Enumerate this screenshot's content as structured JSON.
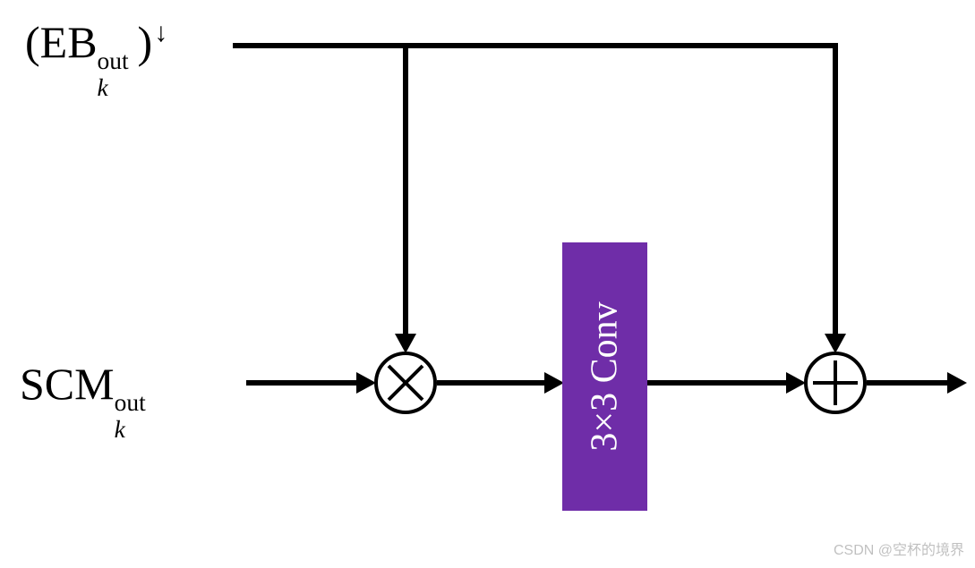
{
  "inputs": {
    "eb": {
      "prefix": "(EB",
      "sup": "out",
      "sub": "k",
      "suffix": ")",
      "arrow_glyph": "↓"
    },
    "scm": {
      "prefix": "SCM",
      "sup": "out",
      "sub": "k"
    }
  },
  "ops": {
    "multiply_symbol": "⊗",
    "add_symbol": "⊕"
  },
  "block": {
    "conv_label": "3×3 Conv"
  },
  "colors": {
    "conv_bg": "#6f2da8",
    "conv_text": "#ffffff",
    "line": "#000000"
  },
  "watermark": "CSDN @空杯的境界"
}
